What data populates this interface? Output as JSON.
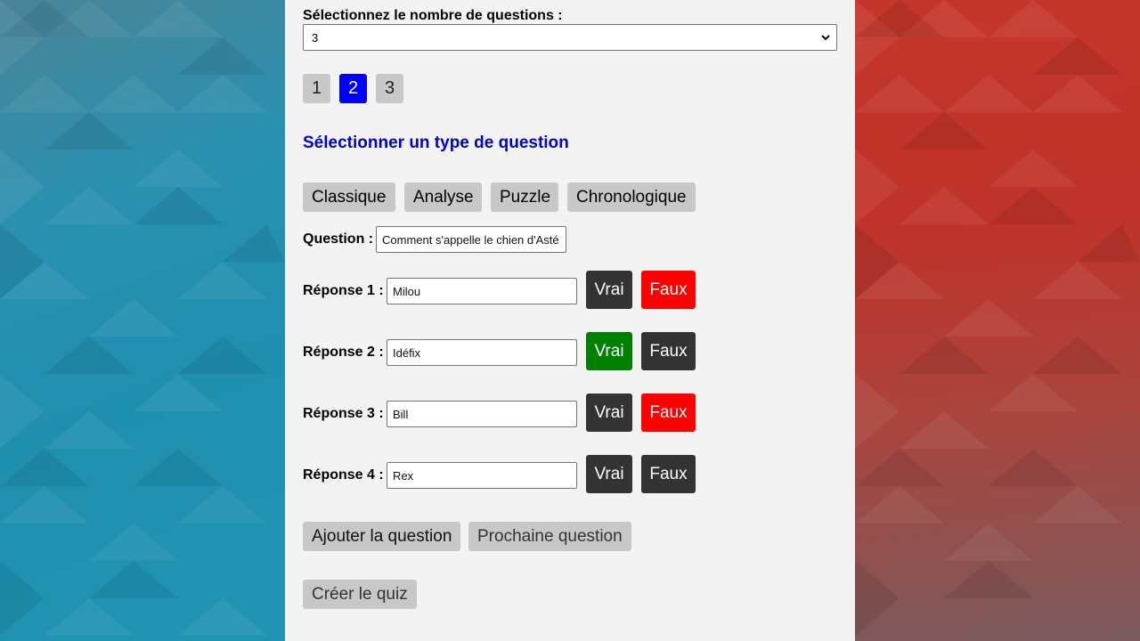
{
  "selector": {
    "label": "Sélectionnez le nombre de questions :",
    "value": "3"
  },
  "pager": {
    "pages": [
      "1",
      "2",
      "3"
    ],
    "active": "2"
  },
  "type_heading": "Sélectionner un type de question",
  "types": [
    "Classique",
    "Analyse",
    "Puzzle",
    "Chronologique"
  ],
  "question": {
    "label": "Question :",
    "value": "Comment s'appelle le chien d'Asté"
  },
  "answers": [
    {
      "label": "Réponse 1 :",
      "value": "Milou",
      "true_label": "Vrai",
      "false_label": "Faux",
      "selected": "false"
    },
    {
      "label": "Réponse 2 :",
      "value": "Idéfix",
      "true_label": "Vrai",
      "false_label": "Faux",
      "selected": "true"
    },
    {
      "label": "Réponse 3 :",
      "value": "Bill",
      "true_label": "Vrai",
      "false_label": "Faux",
      "selected": "false"
    },
    {
      "label": "Réponse 4 :",
      "value": "Rex",
      "true_label": "Vrai",
      "false_label": "Faux",
      "selected": "none"
    }
  ],
  "actions": {
    "add": "Ajouter la question",
    "next": "Prochaine question",
    "create": "Créer le quiz"
  },
  "colors": {
    "active_page": "#0000ff",
    "heading": "#0000cc",
    "true_selected": "#008000",
    "false_selected": "#ff0000",
    "unselected": "#333333"
  }
}
